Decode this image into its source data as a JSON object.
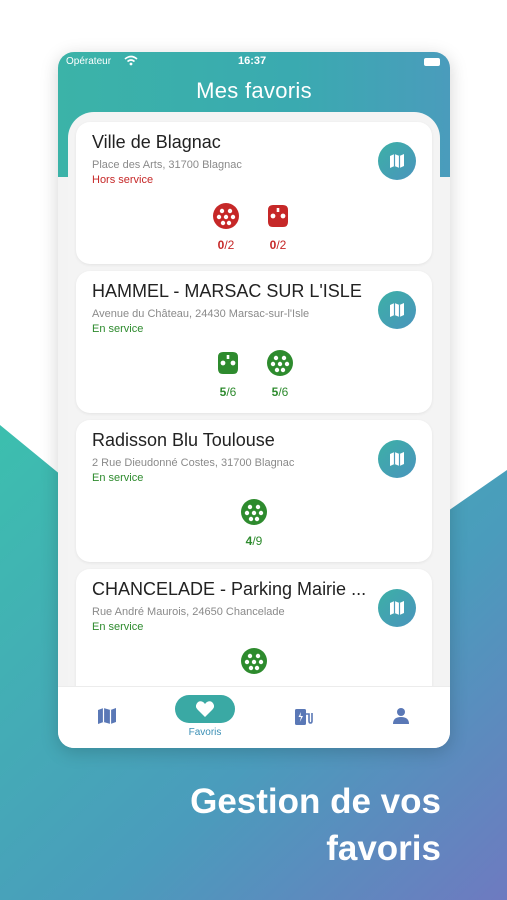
{
  "status_bar": {
    "carrier": "Opérateur",
    "time": "16:37"
  },
  "header": {
    "title": "Mes favoris"
  },
  "colors": {
    "teal": "#3bb3a8",
    "blue": "#4a94bd",
    "status_red": "#c62828",
    "status_green": "#2e8b2e",
    "connector_red": "#c62828",
    "connector_green": "#2e8b2e"
  },
  "favorites": [
    {
      "name": "Ville de Blagnac",
      "address": "Place des Arts, 31700 Blagnac",
      "status": "Hors service",
      "connectors": [
        {
          "icon": "type2-plug-icon",
          "available": "0",
          "total": "/2"
        },
        {
          "icon": "domestic-plug-icon",
          "available": "0",
          "total": "/2"
        }
      ]
    },
    {
      "name": "HAMMEL - MARSAC SUR L'ISLE",
      "address": "Avenue du Château, 24430 Marsac-sur-l'Isle",
      "status": "En service",
      "connectors": [
        {
          "icon": "domestic-plug-icon",
          "available": "5",
          "total": "/6"
        },
        {
          "icon": "type2-plug-icon",
          "available": "5",
          "total": "/6"
        }
      ]
    },
    {
      "name": "Radisson Blu Toulouse",
      "address": "2 Rue Dieudonné Costes, 31700 Blagnac",
      "status": "En service",
      "connectors": [
        {
          "icon": "type2-plug-icon",
          "available": "4",
          "total": "/9"
        }
      ]
    },
    {
      "name": "CHANCELADE - Parking Mairie ...",
      "address": "Rue André Maurois, 24650 Chancelade",
      "status": "En service",
      "connectors": [
        {
          "icon": "type2-plug-icon",
          "available": "",
          "total": ""
        }
      ]
    }
  ],
  "tabbar": {
    "tabs": [
      {
        "icon": "map-icon",
        "label": ""
      },
      {
        "icon": "heart-icon",
        "label": "Favoris",
        "active": true
      },
      {
        "icon": "charging-station-icon",
        "label": ""
      },
      {
        "icon": "user-icon",
        "label": ""
      }
    ]
  },
  "promo": {
    "line1": "Gestion de vos",
    "line2": "favoris"
  }
}
